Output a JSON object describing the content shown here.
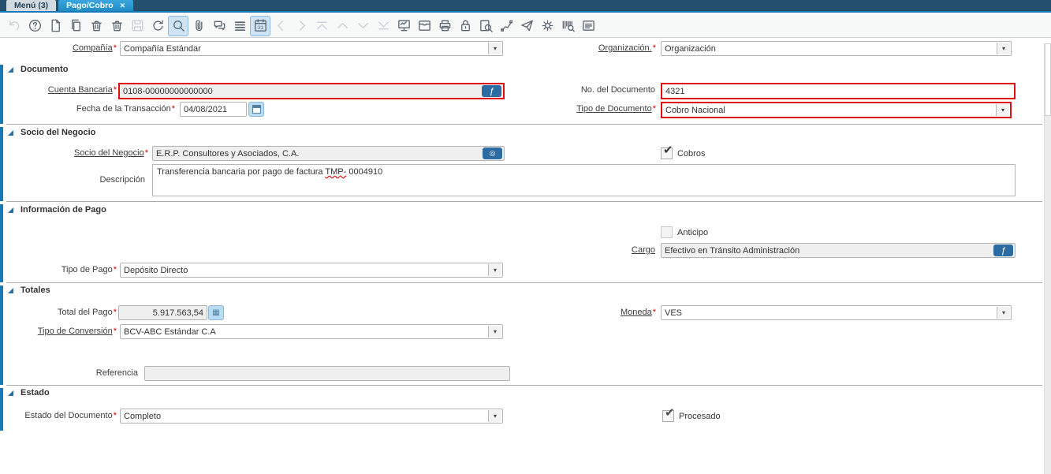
{
  "tabs": {
    "menu": "Menú (3)",
    "active": "Pago/Cobro",
    "close": "✕"
  },
  "toolbar": {
    "icons": [
      {
        "name": "undo",
        "state": "disabled"
      },
      {
        "name": "help",
        "state": "normal"
      },
      {
        "name": "new-record",
        "state": "normal"
      },
      {
        "name": "copy-record",
        "state": "normal"
      },
      {
        "name": "delete-record",
        "state": "normal"
      },
      {
        "name": "delete-selection",
        "state": "normal"
      },
      {
        "name": "save",
        "state": "disabled"
      },
      {
        "name": "refresh",
        "state": "normal"
      },
      {
        "name": "find",
        "state": "highlighted"
      },
      {
        "name": "attachment",
        "state": "normal"
      },
      {
        "name": "chat",
        "state": "normal"
      },
      {
        "name": "grid-toggle",
        "state": "normal"
      },
      {
        "name": "calendar",
        "state": "highlighted"
      },
      {
        "name": "previous-record",
        "state": "disabled"
      },
      {
        "name": "next-record",
        "state": "disabled"
      },
      {
        "name": "first-record",
        "state": "disabled"
      },
      {
        "name": "up",
        "state": "disabled"
      },
      {
        "name": "down",
        "state": "disabled"
      },
      {
        "name": "last-record",
        "state": "disabled"
      },
      {
        "name": "report",
        "state": "normal"
      },
      {
        "name": "archive",
        "state": "normal"
      },
      {
        "name": "print",
        "state": "normal"
      },
      {
        "name": "lock",
        "state": "normal"
      },
      {
        "name": "print-preview",
        "state": "normal"
      },
      {
        "name": "workflow",
        "state": "normal"
      },
      {
        "name": "send-mail",
        "state": "normal"
      },
      {
        "name": "preferences",
        "state": "normal"
      },
      {
        "name": "barcode-scan",
        "state": "normal"
      },
      {
        "name": "help-window",
        "state": "normal"
      }
    ]
  },
  "sections": {
    "documento": "Documento",
    "socio": "Socio del Negocio",
    "info_pago": "Información de Pago",
    "totales": "Totales",
    "estado": "Estado"
  },
  "fields": {
    "compania": {
      "label": "Compañía",
      "req": "*",
      "value": "Compañía Estándar"
    },
    "organizacion": {
      "label": "Organización.",
      "req": "*",
      "value": "Organización"
    },
    "cuenta_bancaria": {
      "label": "Cuenta Bancaria",
      "req": "*",
      "value": "0108-00000000000000",
      "button_glyph": "ƒ"
    },
    "no_documento": {
      "label": "No. del Documento",
      "req": "",
      "value": "4321"
    },
    "fecha": {
      "label": "Fecha de la Transacción",
      "req": "*",
      "value": "04/08/2021"
    },
    "tipo_documento": {
      "label": "Tipo de Documento",
      "req": "*",
      "value": "Cobro Nacional"
    },
    "socio": {
      "label": "Socio del Negocio",
      "req": "*",
      "value": "E.R.P. Consultores y Asociados, C.A.",
      "button_glyph": "◎"
    },
    "cobros": {
      "label": "Cobros",
      "checked": true
    },
    "descripcion": {
      "label": "Descripción",
      "req": "",
      "value_part1": "Transferencia bancaria por pago de factura ",
      "value_misspelled": "TMP-",
      "value_part2": " 0004910"
    },
    "anticipo": {
      "label": "Anticipo",
      "checked": false
    },
    "cargo": {
      "label": "Cargo",
      "req": "",
      "value": "Efectivo en Tránsito Administración",
      "button_glyph": "ƒ"
    },
    "tipo_pago": {
      "label": "Tipo de Pago",
      "req": "*",
      "value": "Depósito Directo"
    },
    "total_pago": {
      "label": "Total del Pago",
      "req": "*",
      "value": "5.917.563,54"
    },
    "moneda": {
      "label": "Moneda",
      "req": "*",
      "value": "VES"
    },
    "tipo_conversion": {
      "label": "Tipo de Conversión",
      "req": "*",
      "value": "BCV-ABC Estándar C.A"
    },
    "referencia": {
      "label": "Referencia",
      "req": "",
      "value": ""
    },
    "estado_documento": {
      "label": "Estado del Documento",
      "req": "*",
      "value": "Completo"
    },
    "procesado": {
      "label": "Procesado",
      "checked": true
    }
  },
  "glyphs": {
    "dropdown": "▾",
    "check": "✔",
    "calc": "▦"
  },
  "colors": {
    "accent_blue": "#1779b8",
    "tab_active": "#2e9ad4",
    "required_red": "#cf0000",
    "error_border": "#e01010",
    "button_blue": "#2d6ca2"
  }
}
